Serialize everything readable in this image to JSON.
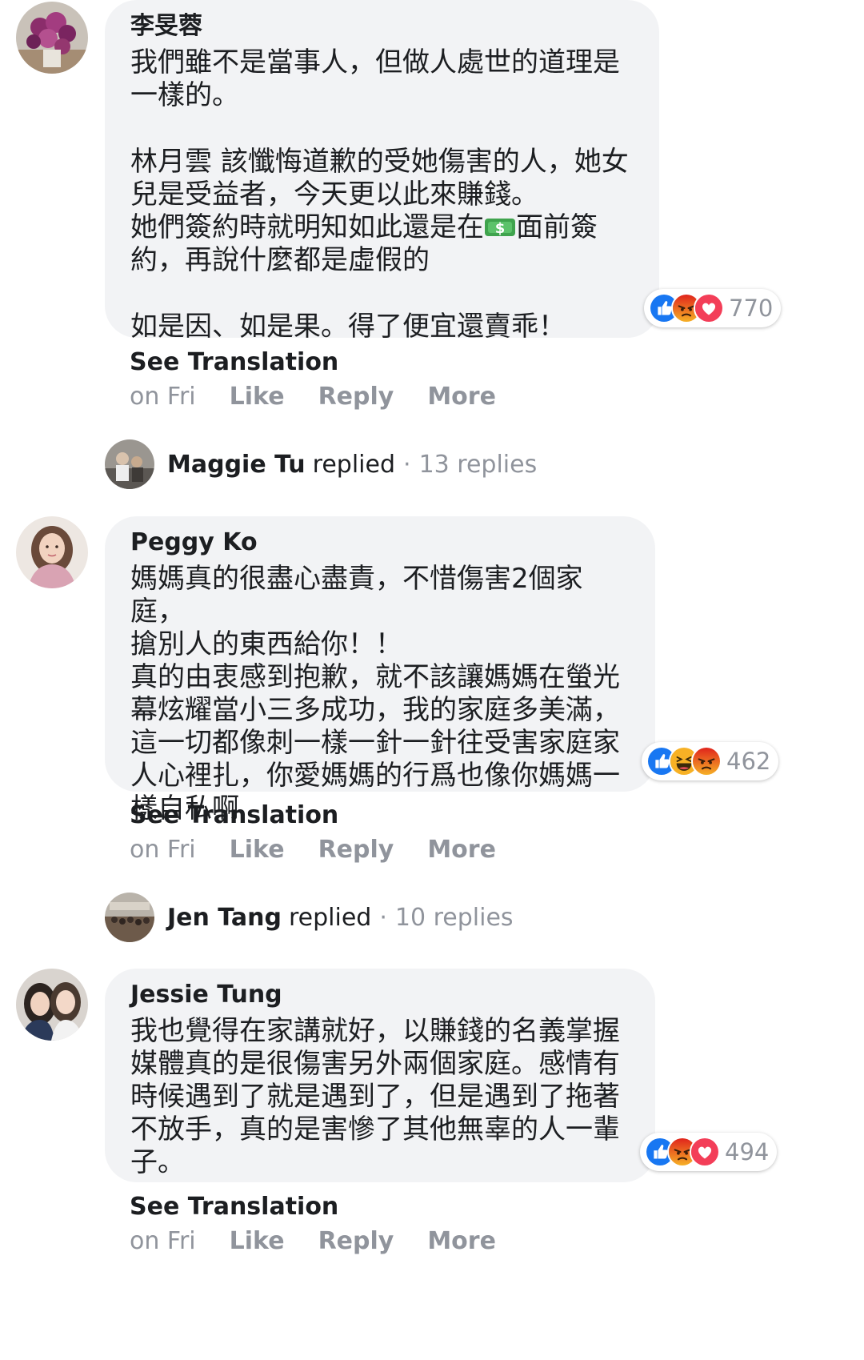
{
  "comments": [
    {
      "author": "李旻蓉",
      "paragraphs": [
        "我們雖不是當事人，但做人處世的道理是\n一樣的。",
        "林月雲 該懺悔道歉的受她傷害的人，她女\n兒是受益者，今天更以此來賺錢。\n她們簽約時就明知如此還是在",
        "面前簽\n約，再說什麼都是虛假的",
        "如是因、如是果。得了便宜還賣乖！"
      ],
      "reactions": [
        "like",
        "angry",
        "love"
      ],
      "reaction_count": "770",
      "see_translation": "See Translation",
      "time": "on Fri",
      "like": "Like",
      "reply": "Reply",
      "more": "More"
    },
    {
      "author": "Peggy Ko",
      "text": "媽媽真的很盡心盡責，不惜傷害2個家庭，\n搶別人的東西給你！！\n真的由衷感到抱歉，就不該讓媽媽在螢光\n幕炫耀當小三多成功，我的家庭多美滿，\n這一切都像刺一樣一針一針往受害家庭家\n人心裡扎，你愛媽媽的行爲也像你媽媽一\n樣自私啊",
      "reactions": [
        "like",
        "haha",
        "angry"
      ],
      "reaction_count": "462",
      "see_translation": "See Translation",
      "time": "on Fri",
      "like": "Like",
      "reply": "Reply",
      "more": "More"
    },
    {
      "author": "Jessie Tung",
      "text": "我也覺得在家講就好，以賺錢的名義掌握\n媒體真的是很傷害另外兩個家庭。感情有\n時候遇到了就是遇到了，但是遇到了拖著\n不放手，真的是害慘了其他無辜的人一輩\n子。",
      "reactions": [
        "like",
        "angry",
        "love"
      ],
      "reaction_count": "494",
      "see_translation": "See Translation",
      "time": "on Fri",
      "like": "Like",
      "reply": "Reply",
      "more": "More"
    }
  ],
  "replies": [
    {
      "name": "Maggie Tu",
      "verb": "replied",
      "separator": "·",
      "count": "13 replies"
    },
    {
      "name": "Jen Tang",
      "verb": "replied",
      "separator": "·",
      "count": "10 replies"
    }
  ],
  "colors": {
    "bubble": "#f2f3f5",
    "meta_text": "#90949c",
    "like_blue": "#1877f2",
    "love_red": "#f33e58",
    "angry_orange": "#e9710f",
    "haha_yellow": "#f7b125"
  },
  "icons": {
    "like": "thumbs-up-icon",
    "love": "heart-icon",
    "angry": "angry-face-icon",
    "haha": "laughing-face-icon",
    "money": "money-emoji-icon"
  }
}
